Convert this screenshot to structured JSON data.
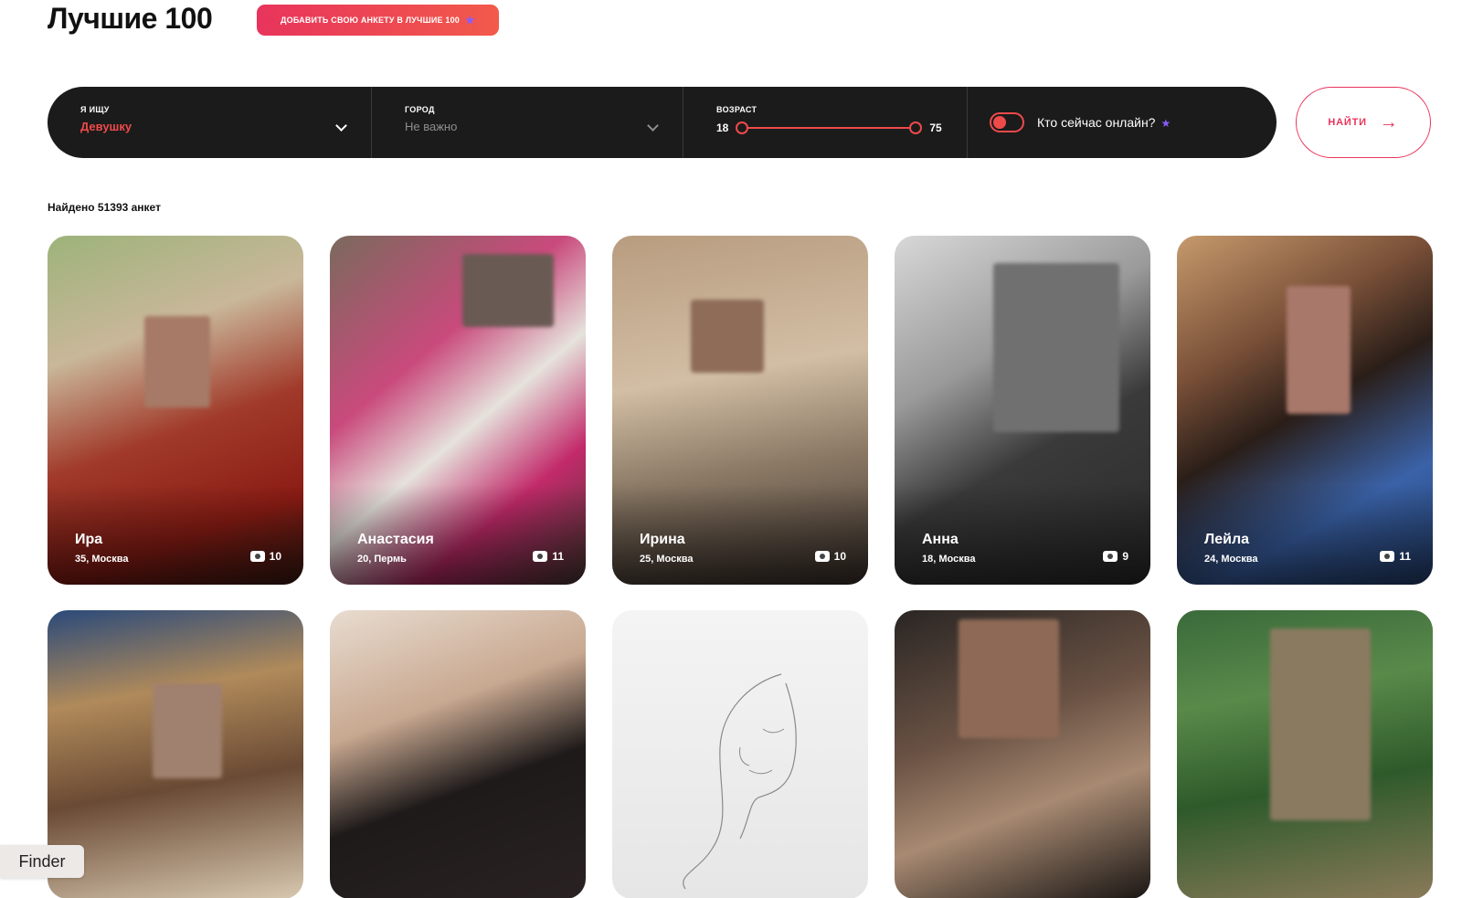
{
  "header": {
    "title": "Лучшие 100",
    "promo_button": "ДОБАВИТЬ СВОЮ АНКЕТУ В ЛУЧШИЕ 100"
  },
  "filters": {
    "seek_label": "Я ИЩУ",
    "seek_value": "Девушку",
    "city_label": "ГОРОД",
    "city_value": "Не важно",
    "age_label": "ВОЗРАСТ",
    "age_min": "18",
    "age_max": "75",
    "online_label": "Кто сейчас онлайн?",
    "find_button": "НАЙТИ"
  },
  "results": {
    "found_text": "Найдено 51393 анкет"
  },
  "cards": [
    {
      "name": "Ира",
      "meta": "35, Москва",
      "photos": "10"
    },
    {
      "name": "Анастасия",
      "meta": "20, Пермь",
      "photos": "11"
    },
    {
      "name": "Ирина",
      "meta": "25, Москва",
      "photos": "10"
    },
    {
      "name": "Анна",
      "meta": "18, Москва",
      "photos": "9"
    },
    {
      "name": "Лейла",
      "meta": "24, Москва",
      "photos": "11"
    }
  ],
  "overlay": {
    "finder_label": "Finder"
  },
  "colors": {
    "accent": "#ee4a4a",
    "brand_gradient_start": "#e8345c",
    "star": "#8a5cff",
    "filter_bar_bg": "#1b1b1b"
  }
}
